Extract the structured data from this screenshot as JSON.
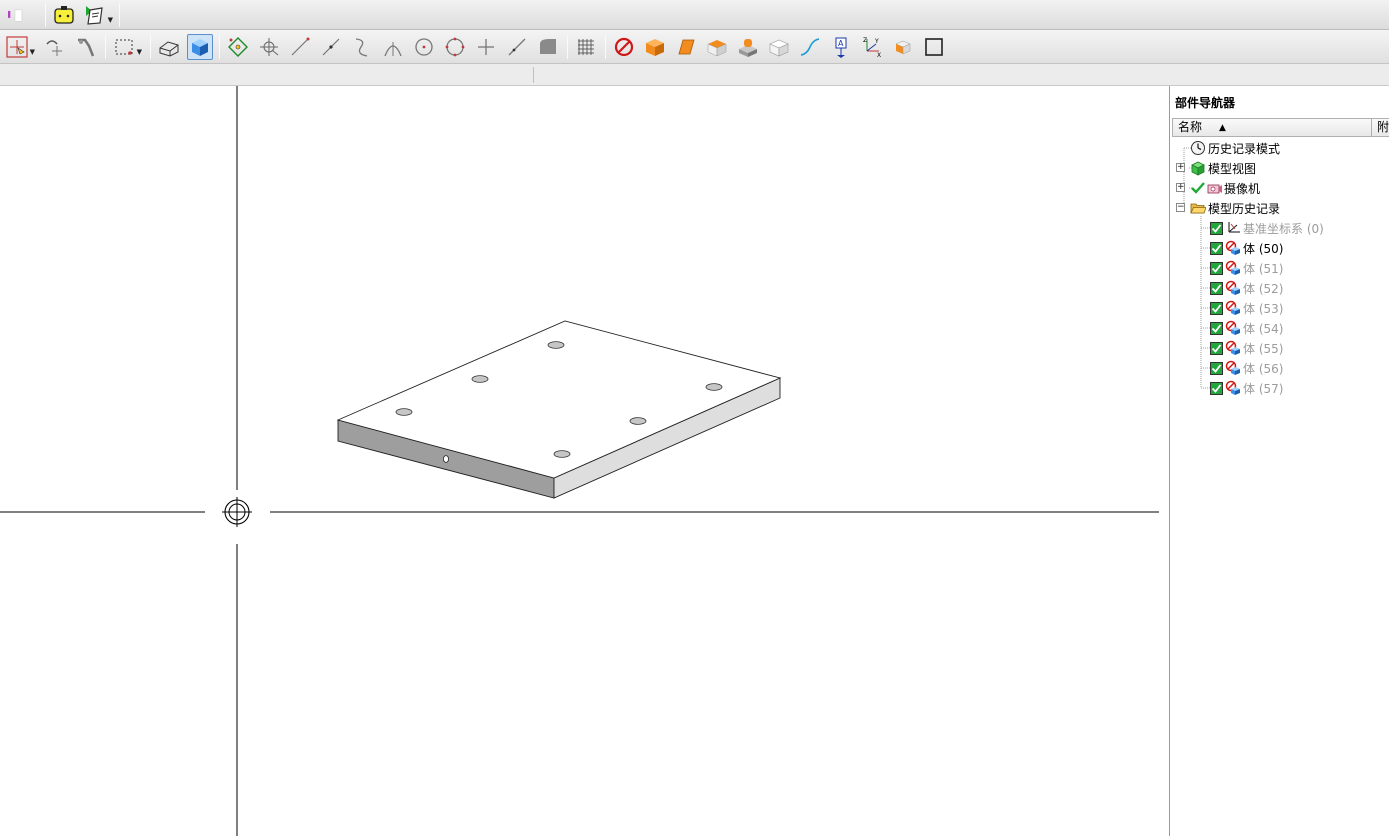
{
  "toolbar_top": {
    "icons": [
      "feature-icon",
      "part-box-icon",
      "report-icon"
    ]
  },
  "toolbar_main": {
    "icons": [
      "snap-point-icon",
      "curve-rule-icon",
      "selection-intent-icon",
      "rectangle-select-icon",
      "shaded-edges-icon",
      "shaded-icon",
      "snap-control-point-icon",
      "snap-existing-point-icon",
      "snap-end-point-icon",
      "snap-mid-point-icon",
      "snap-curve-icon",
      "snap-intersection-icon",
      "snap-arc-center-icon",
      "snap-quadrant-icon",
      "snap-point-on-curve-icon",
      "snap-point-on-face-icon",
      "snap-bounded-grid-icon",
      "grid-icon",
      "clear-snap-icon",
      "body-icon",
      "face-icon",
      "solid-body-icon",
      "assembly-feature-icon",
      "sheet-body-icon",
      "curve-spline-icon",
      "annotation-icon",
      "csys-icon",
      "component-icon",
      "frame-icon"
    ]
  },
  "navigator": {
    "title": "部件导航器",
    "columns": {
      "name": "名称",
      "attach": "附"
    },
    "nodes": [
      {
        "label": "历史记录模式",
        "icon": "clock-icon",
        "expandable": false,
        "dim": false
      },
      {
        "label": "模型视图",
        "icon": "model-view-icon",
        "expandable": true,
        "dim": false
      },
      {
        "label": "摄像机",
        "icon": "camera-icon",
        "expandable": true,
        "dim": false
      },
      {
        "label": "模型历史记录",
        "icon": "folder-open-icon",
        "expandable": true,
        "expanded": true,
        "dim": false
      }
    ],
    "history": [
      {
        "label": "基准坐标系 (0)",
        "icon": "datum-csys-icon",
        "dim": true
      },
      {
        "label": "体 (50)",
        "icon": "body-feature-icon",
        "dim": false
      },
      {
        "label": "体 (51)",
        "icon": "body-feature-icon",
        "dim": true
      },
      {
        "label": "体 (52)",
        "icon": "body-feature-icon",
        "dim": true
      },
      {
        "label": "体 (53)",
        "icon": "body-feature-icon",
        "dim": true
      },
      {
        "label": "体 (54)",
        "icon": "body-feature-icon",
        "dim": true
      },
      {
        "label": "体 (55)",
        "icon": "body-feature-icon",
        "dim": true
      },
      {
        "label": "体 (56)",
        "icon": "body-feature-icon",
        "dim": true
      },
      {
        "label": "体 (57)",
        "icon": "body-feature-icon",
        "dim": true
      }
    ]
  },
  "colors": {
    "accent_orange": "#f28c1e",
    "check_green": "#22a53a",
    "dim_text": "#9c9c9c"
  }
}
